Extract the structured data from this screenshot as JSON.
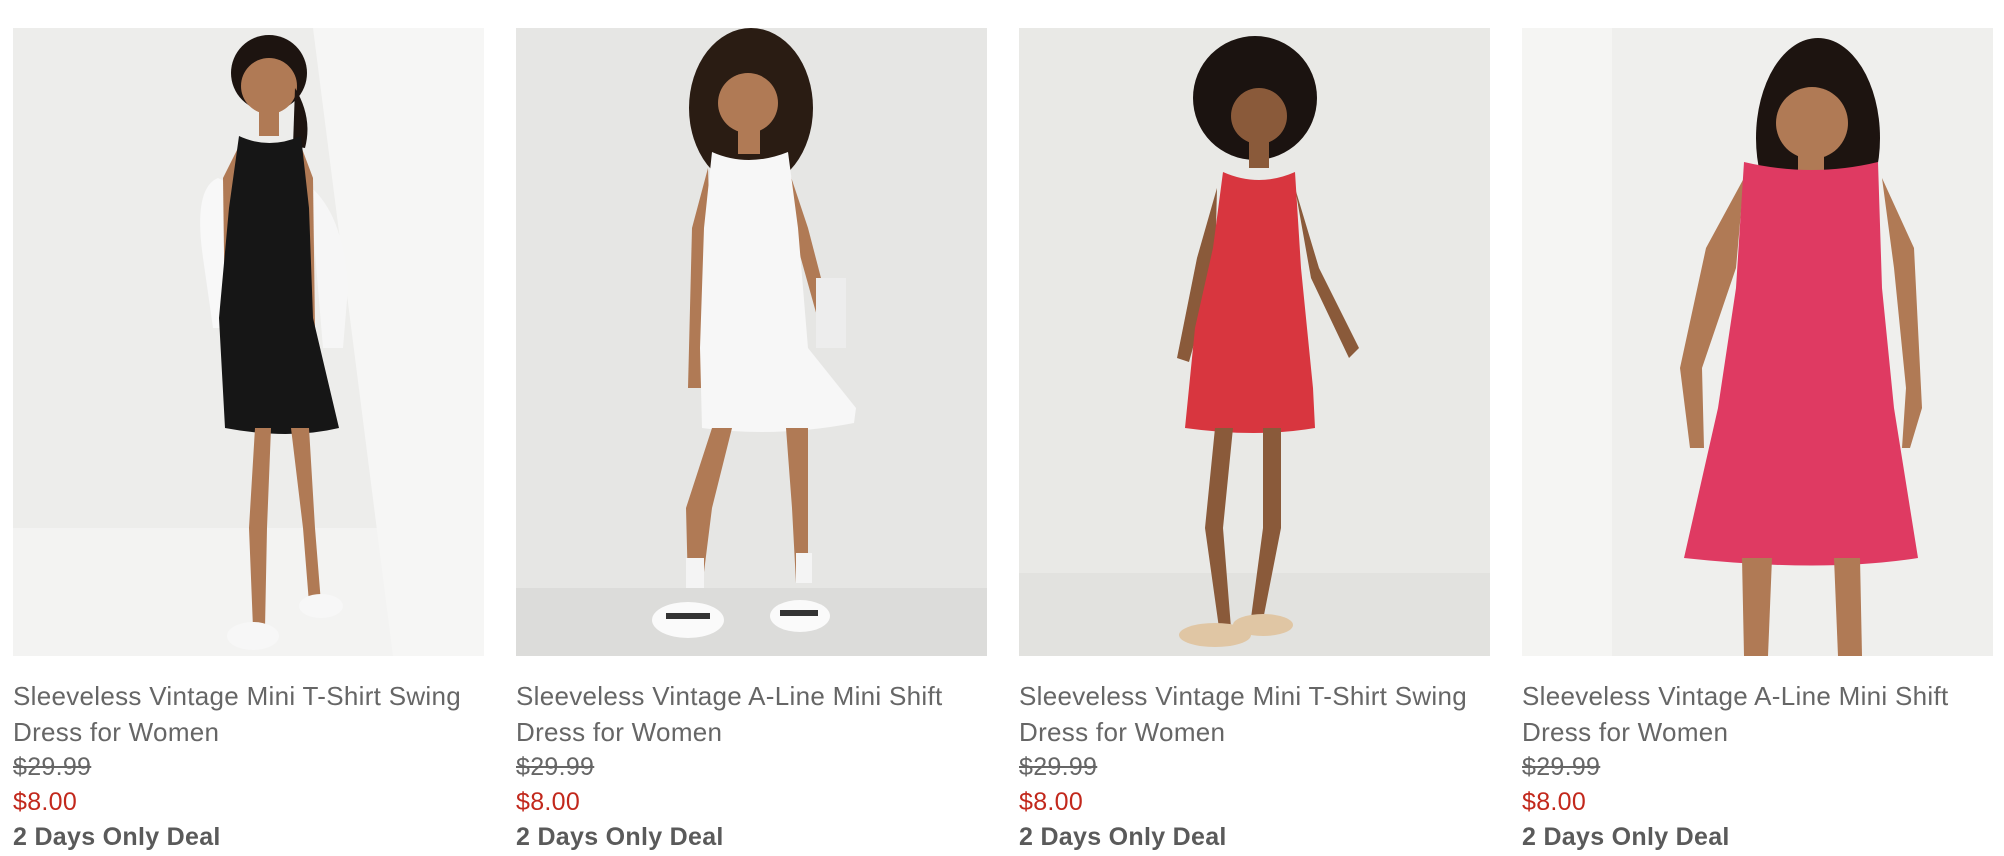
{
  "products": [
    {
      "name": "Sleeveless Vintage Mini T-Shirt Swing Dress for Women",
      "original_price": "$29.99",
      "sale_price": "$8.00",
      "deal": "2 Days Only Deal",
      "dress_color": "#161616",
      "backdrop": "#ededeb",
      "floor": "#f3f3f2"
    },
    {
      "name": "Sleeveless Vintage A-Line Mini Shift Dress for Women",
      "original_price": "$29.99",
      "sale_price": "$8.00",
      "deal": "2 Days Only Deal",
      "dress_color": "#f7f7f7",
      "backdrop": "#e6e6e4",
      "floor": "#dcdcda"
    },
    {
      "name": "Sleeveless Vintage Mini T-Shirt Swing Dress for Women",
      "original_price": "$29.99",
      "sale_price": "$8.00",
      "deal": "2 Days Only Deal",
      "dress_color": "#d8363f",
      "backdrop": "#e9e9e6",
      "floor": "#e2e2df"
    },
    {
      "name": "Sleeveless Vintage A-Line Mini Shift Dress for Women",
      "original_price": "$29.99",
      "sale_price": "$8.00",
      "deal": "2 Days Only Deal",
      "dress_color": "#df3a62",
      "backdrop": "#efefed",
      "floor": "#ecece9"
    }
  ],
  "colors": {
    "sale_price": "#c2281c",
    "text": "#666666",
    "skin": "#b07a55",
    "hair": "#1d1410"
  }
}
